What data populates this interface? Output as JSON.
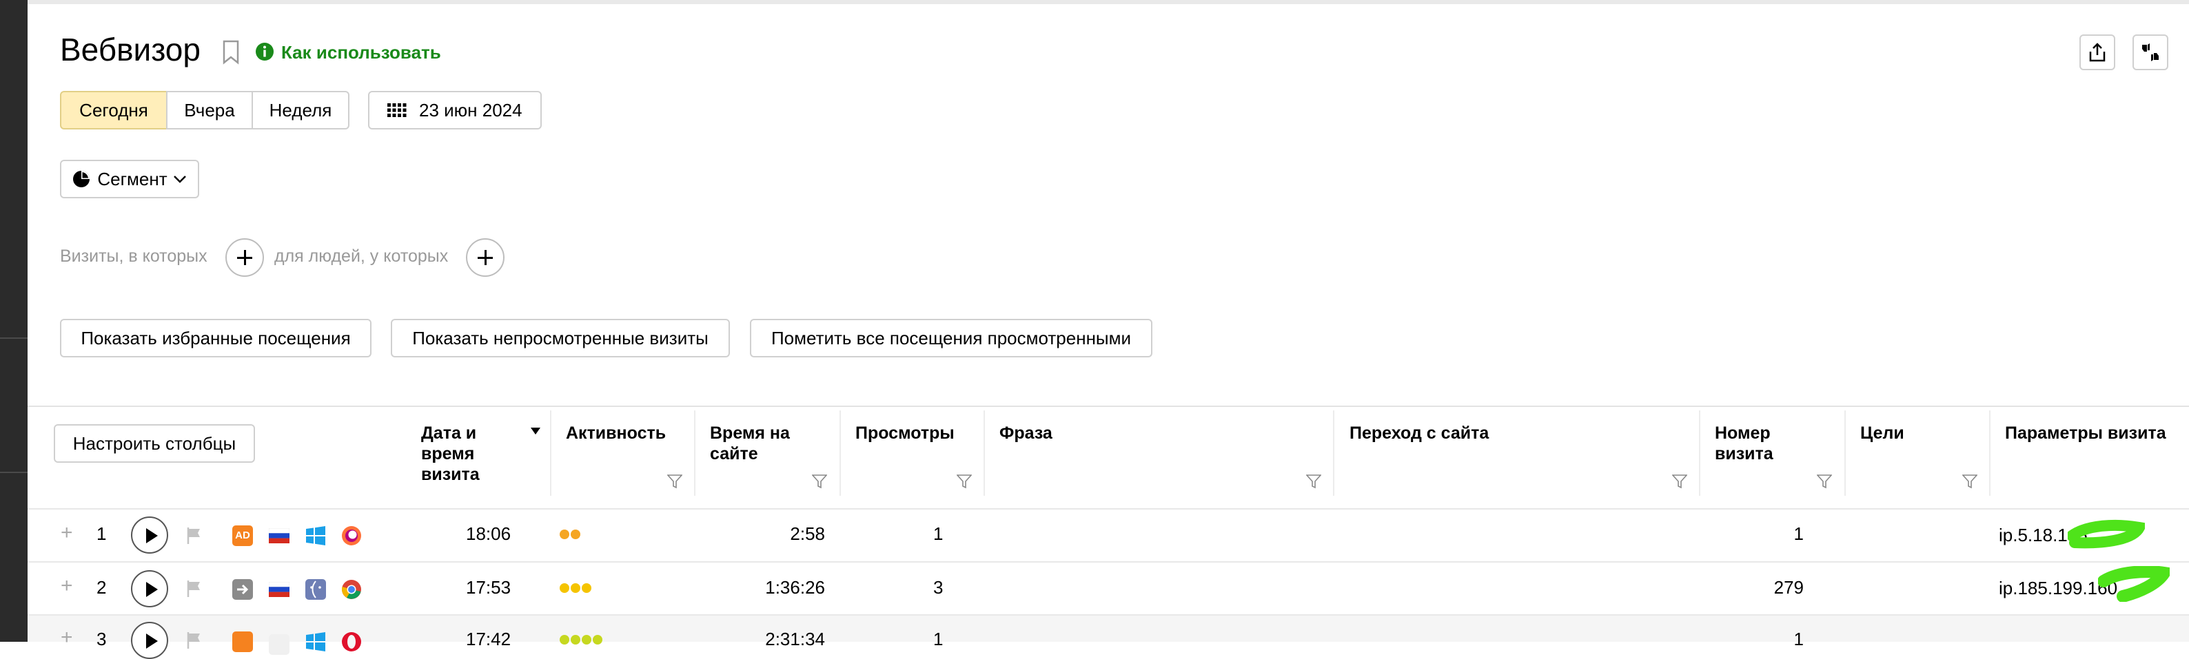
{
  "header": {
    "title": "Вебвизор",
    "how_to_use": "Как использовать"
  },
  "period": {
    "today": "Сегодня",
    "yesterday": "Вчера",
    "week": "Неделя",
    "date": "23 июн 2024"
  },
  "segment": {
    "label": "Сегмент"
  },
  "filters": {
    "visits_where": "Визиты, в которых",
    "people_where": "для людей, у которых"
  },
  "actions": {
    "show_favorites": "Показать избранные посещения",
    "show_unviewed": "Показать непросмотренные визиты",
    "mark_all_viewed": "Пометить все посещения просмотренными"
  },
  "table": {
    "configure_columns": "Настроить столбцы",
    "columns": {
      "datetime": "Дата и время визита",
      "activity": "Активность",
      "time_on_site": "Время на сайте",
      "views": "Просмотры",
      "phrase": "Фраза",
      "referrer": "Переход с сайта",
      "visit_number": "Номер визита",
      "goals": "Цели",
      "visit_params": "Параметры визита"
    },
    "rows": [
      {
        "num": "1",
        "time": "18:06",
        "duration": "2:58",
        "views": "1",
        "visit_no": "1",
        "params": "ip.5.18.145",
        "activity_level": 2,
        "activity_color": "#f5a623"
      },
      {
        "num": "2",
        "time": "17:53",
        "duration": "1:36:26",
        "views": "3",
        "visit_no": "279",
        "params": "ip.185.199.160",
        "activity_level": 3,
        "activity_color": "#f5c400"
      },
      {
        "num": "3",
        "time": "17:42",
        "duration": "2:31:34",
        "views": "1",
        "visit_no": "1",
        "params": "",
        "activity_level": 4,
        "activity_color": "#c6d820"
      }
    ]
  },
  "colors": {
    "accent_green": "#1a8a1a",
    "active_period": "#ffeeba",
    "redaction_green": "#4fe31a"
  }
}
